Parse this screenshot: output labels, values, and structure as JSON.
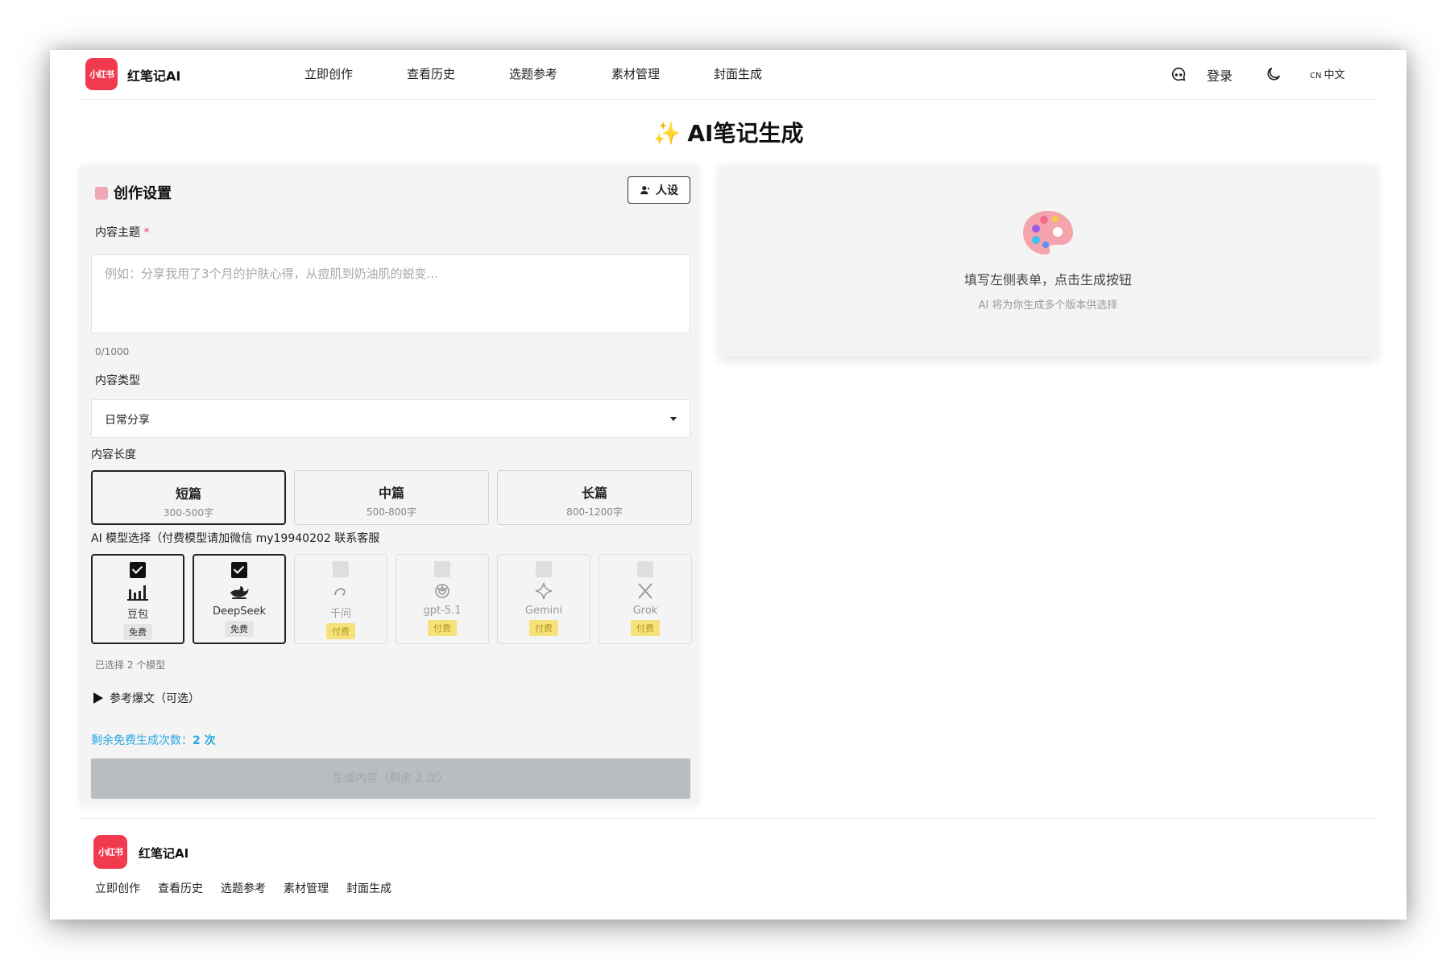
{
  "header": {
    "logo_text": "小红书",
    "brand": "红笔记AI",
    "nav": [
      "立即创作",
      "查看历史",
      "选题参考",
      "素材管理",
      "封面生成"
    ],
    "login": "登录",
    "lang_code": "CN",
    "lang": "中文"
  },
  "page_title": "AI笔记生成",
  "settings": {
    "title": "创作设置",
    "persona_button": "人设",
    "topic_label": "内容主题",
    "topic_required": "*",
    "topic_placeholder": "例如：分享我用了3个月的护肤心得，从痘肌到奶油肌的蜕变...",
    "char_count": "0/1000",
    "type_label": "内容类型",
    "type_value": "日常分享",
    "length_label": "内容长度",
    "lengths": [
      {
        "name": "短篇",
        "range": "300-500字",
        "active": true
      },
      {
        "name": "中篇",
        "range": "500-800字",
        "active": false
      },
      {
        "name": "长篇",
        "range": "800-1200字",
        "active": false
      }
    ],
    "model_label": "AI 模型选择（付费模型请加微信 my19940202 联系客服",
    "models": [
      {
        "name": "豆包",
        "badge": "免费",
        "checked": true,
        "icon": "bar-chart-icon"
      },
      {
        "name": "DeepSeek",
        "badge": "免费",
        "checked": true,
        "icon": "whale-icon"
      },
      {
        "name": "千问",
        "badge": "付费",
        "checked": false,
        "icon": "qwen-icon"
      },
      {
        "name": "gpt-5.1",
        "badge": "付费",
        "checked": false,
        "icon": "openai-icon"
      },
      {
        "name": "Gemini",
        "badge": "付费",
        "checked": false,
        "icon": "sparkle-icon"
      },
      {
        "name": "Grok",
        "badge": "付费",
        "checked": false,
        "icon": "x-icon"
      }
    ],
    "selected_count": "已选择 2 个模型",
    "reference": "参考爆文（可选）",
    "remaining_label": "剩余免费生成次数：",
    "remaining_value": "2 次",
    "generate_button": "生成内容（剩余 2 次）"
  },
  "empty_state": {
    "title": "填写左侧表单，点击生成按钮",
    "subtitle": "AI 将为你生成多个版本供选择"
  },
  "footer": {
    "logo_text": "小红书",
    "brand": "红笔记AI",
    "nav": [
      "立即创作",
      "查看历史",
      "选题参考",
      "素材管理",
      "封面生成"
    ]
  },
  "colors": {
    "brand": "#f23a4f",
    "accent": "#27a8e0",
    "paid_badge": "#f6e27a"
  }
}
